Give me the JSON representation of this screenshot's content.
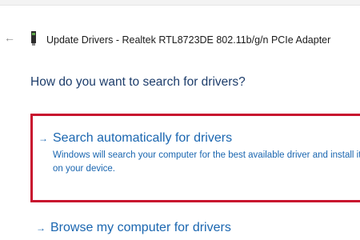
{
  "window": {
    "title": "Update Drivers - Realtek RTL8723DE 802.11b/g/n PCIe Adapter",
    "back_glyph": "←",
    "device_icon": "network-adapter-icon"
  },
  "page": {
    "heading": "How do you want to search for drivers?"
  },
  "options": [
    {
      "arrow": "→",
      "title": "Search automatically for drivers",
      "description": "Windows will search your computer for the best available driver and install it on your device.",
      "highlighted": true
    },
    {
      "arrow": "→",
      "title": "Browse my computer for drivers"
    }
  ],
  "colors": {
    "link": "#1a66b0",
    "heading": "#1d3d6b",
    "highlight": "#c8102e"
  }
}
